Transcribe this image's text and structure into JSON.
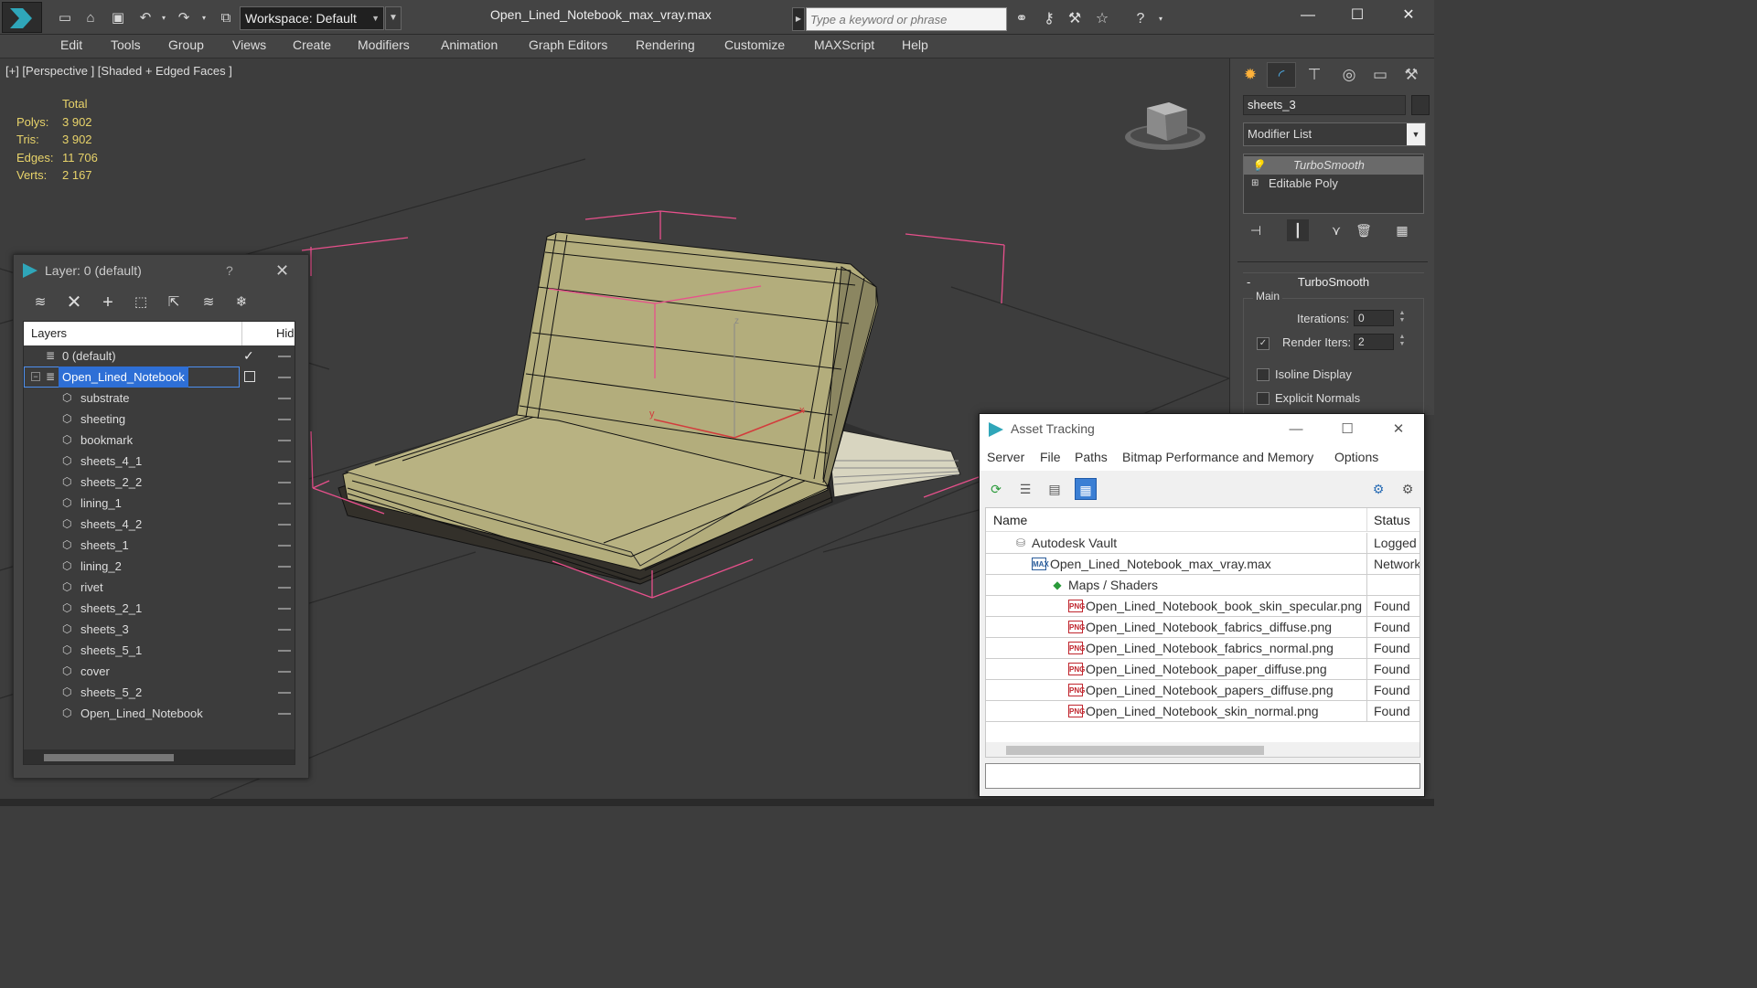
{
  "titlebar": {
    "workspace_label": "Workspace: Default",
    "document_title": "Open_Lined_Notebook_max_vray.max",
    "search_placeholder": "Type a keyword or phrase"
  },
  "menu": [
    "Edit",
    "Tools",
    "Group",
    "Views",
    "Create",
    "Modifiers",
    "Animation",
    "Graph Editors",
    "Rendering",
    "Customize",
    "MAXScript",
    "Help"
  ],
  "viewport": {
    "label": "[+] [Perspective ] [Shaded + Edged Faces ]",
    "stats": {
      "header": "Total",
      "rows": [
        {
          "key": "Polys:",
          "value": "3 902"
        },
        {
          "key": "Tris:",
          "value": "3 902"
        },
        {
          "key": "Edges:",
          "value": "11 706"
        },
        {
          "key": "Verts:",
          "value": "2 167"
        }
      ]
    },
    "model_color": "#b3ad7c",
    "selection_color": "#e8508c"
  },
  "command_panel": {
    "object_name": "sheets_3",
    "modifier_list": "Modifier List",
    "stack": [
      "TurboSmooth",
      "Editable Poly"
    ],
    "rollout_title": "TurboSmooth",
    "group_main": "Main",
    "iterations_label": "Iterations:",
    "iterations_value": "0",
    "render_iters_label": "Render Iters:",
    "render_iters_value": "2",
    "render_iters_checked": true,
    "isoline_label": "Isoline Display",
    "explicit_normals_label": "Explicit Normals"
  },
  "layer_dialog": {
    "title": "Layer: 0 (default)",
    "help": "?",
    "col_layers": "Layers",
    "col_hide": "Hid",
    "rows": [
      {
        "name": "0 (default)",
        "level": 0,
        "type": "layer"
      },
      {
        "name": "Open_Lined_Notebook",
        "level": 0,
        "type": "layer",
        "selected": true
      },
      {
        "name": "substrate",
        "level": 1,
        "type": "object"
      },
      {
        "name": "sheeting",
        "level": 1,
        "type": "object"
      },
      {
        "name": "bookmark",
        "level": 1,
        "type": "object"
      },
      {
        "name": "sheets_4_1",
        "level": 1,
        "type": "object"
      },
      {
        "name": "sheets_2_2",
        "level": 1,
        "type": "object"
      },
      {
        "name": "lining_1",
        "level": 1,
        "type": "object"
      },
      {
        "name": "sheets_4_2",
        "level": 1,
        "type": "object"
      },
      {
        "name": "sheets_1",
        "level": 1,
        "type": "object"
      },
      {
        "name": "lining_2",
        "level": 1,
        "type": "object"
      },
      {
        "name": "rivet",
        "level": 1,
        "type": "object"
      },
      {
        "name": "sheets_2_1",
        "level": 1,
        "type": "object"
      },
      {
        "name": "sheets_3",
        "level": 1,
        "type": "object"
      },
      {
        "name": "sheets_5_1",
        "level": 1,
        "type": "object"
      },
      {
        "name": "cover",
        "level": 1,
        "type": "object"
      },
      {
        "name": "sheets_5_2",
        "level": 1,
        "type": "object"
      },
      {
        "name": "Open_Lined_Notebook",
        "level": 1,
        "type": "object"
      }
    ]
  },
  "asset_dialog": {
    "title": "Asset Tracking",
    "menu": [
      "Server",
      "File",
      "Paths",
      "Bitmap Performance and Memory",
      "Options"
    ],
    "col_name": "Name",
    "col_status": "Status",
    "rows": [
      {
        "name": "Autodesk Vault",
        "status": "Logged",
        "level": 0,
        "icon": "vault"
      },
      {
        "name": "Open_Lined_Notebook_max_vray.max",
        "status": "Network",
        "level": 1,
        "icon": "max"
      },
      {
        "name": "Maps / Shaders",
        "status": "",
        "level": 2,
        "icon": "maps"
      },
      {
        "name": "Open_Lined_Notebook_book_skin_specular.png",
        "status": "Found",
        "level": 3,
        "icon": "png"
      },
      {
        "name": "Open_Lined_Notebook_fabrics_diffuse.png",
        "status": "Found",
        "level": 3,
        "icon": "png"
      },
      {
        "name": "Open_Lined_Notebook_fabrics_normal.png",
        "status": "Found",
        "level": 3,
        "icon": "png"
      },
      {
        "name": "Open_Lined_Notebook_paper_diffuse.png",
        "status": "Found",
        "level": 3,
        "icon": "png"
      },
      {
        "name": "Open_Lined_Notebook_papers_diffuse.png",
        "status": "Found",
        "level": 3,
        "icon": "png"
      },
      {
        "name": "Open_Lined_Notebook_skin_normal.png",
        "status": "Found",
        "level": 3,
        "icon": "png"
      }
    ],
    "png_badge": "PNG",
    "max_badge": "MAX"
  }
}
